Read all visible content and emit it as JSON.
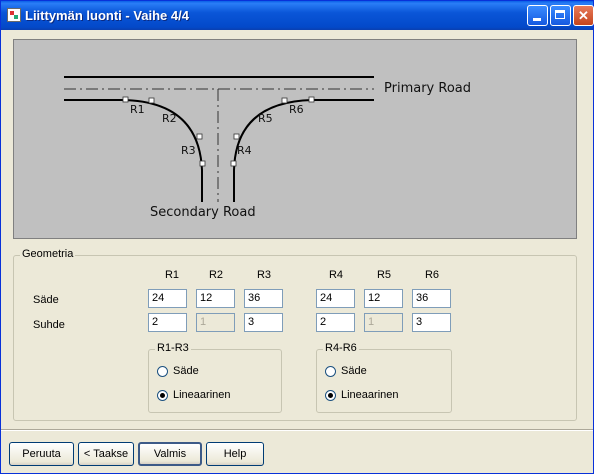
{
  "window": {
    "title": "Liittymän luonti - Vaihe 4/4",
    "close_glyph": "✕"
  },
  "diagram": {
    "primary_road": "Primary Road",
    "secondary_road": "Secondary Road",
    "radius_labels": [
      "R1",
      "R2",
      "R3",
      "R4",
      "R5",
      "R6"
    ]
  },
  "geometry": {
    "group_title": "Geometria",
    "columns": [
      "R1",
      "R2",
      "R3",
      "R4",
      "R5",
      "R6"
    ],
    "row_labels": {
      "sade": "Säde",
      "suhde": "Suhde"
    },
    "sade": [
      "24",
      "12",
      "36",
      "24",
      "12",
      "36"
    ],
    "suhde": [
      "2",
      "1",
      "3",
      "2",
      "1",
      "3"
    ],
    "group_r1r3": {
      "title": "R1-R3",
      "options": [
        "Säde",
        "Lineaarinen"
      ],
      "selected": "Lineaarinen"
    },
    "group_r4r6": {
      "title": "R4-R6",
      "options": [
        "Säde",
        "Lineaarinen"
      ],
      "selected": "Lineaarinen"
    }
  },
  "buttons": {
    "cancel": "Peruuta",
    "back": "< Taakse",
    "finish": "Valmis",
    "help": "Help"
  }
}
